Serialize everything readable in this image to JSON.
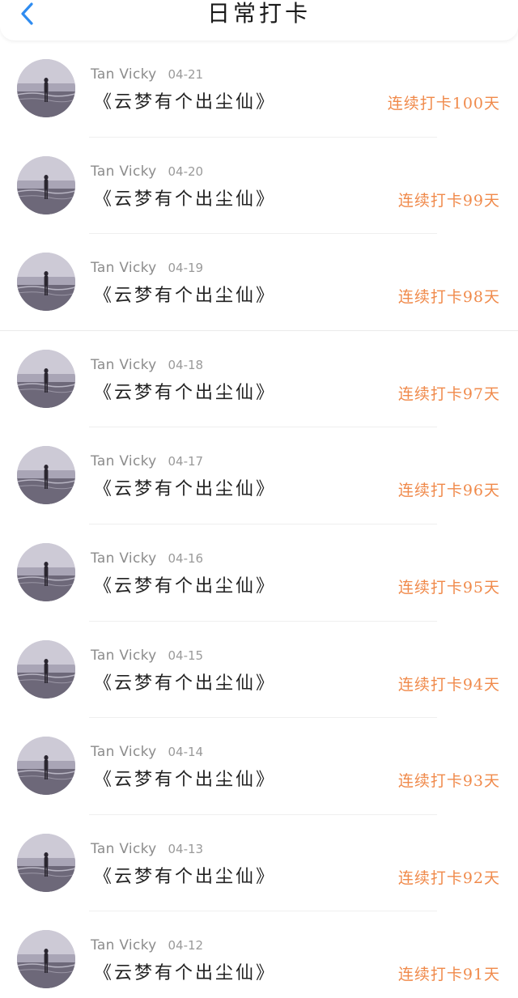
{
  "header": {
    "title": "日常打卡"
  },
  "colors": {
    "back_arrow": "#2f8cf0",
    "streak": "#f08a4b"
  },
  "entries": [
    {
      "user": "Tan Vicky",
      "date": "04-21",
      "book": "《云梦有个出尘仙》",
      "streak": "连续打卡100天"
    },
    {
      "user": "Tan Vicky",
      "date": "04-20",
      "book": "《云梦有个出尘仙》",
      "streak": "连续打卡99天"
    },
    {
      "user": "Tan Vicky",
      "date": "04-19",
      "book": "《云梦有个出尘仙》",
      "streak": "连续打卡98天"
    },
    {
      "user": "Tan Vicky",
      "date": "04-18",
      "book": "《云梦有个出尘仙》",
      "streak": "连续打卡97天"
    },
    {
      "user": "Tan Vicky",
      "date": "04-17",
      "book": "《云梦有个出尘仙》",
      "streak": "连续打卡96天"
    },
    {
      "user": "Tan Vicky",
      "date": "04-16",
      "book": "《云梦有个出尘仙》",
      "streak": "连续打卡95天"
    },
    {
      "user": "Tan Vicky",
      "date": "04-15",
      "book": "《云梦有个出尘仙》",
      "streak": "连续打卡94天"
    },
    {
      "user": "Tan Vicky",
      "date": "04-14",
      "book": "《云梦有个出尘仙》",
      "streak": "连续打卡93天"
    },
    {
      "user": "Tan Vicky",
      "date": "04-13",
      "book": "《云梦有个出尘仙》",
      "streak": "连续打卡92天"
    },
    {
      "user": "Tan Vicky",
      "date": "04-12",
      "book": "《云梦有个出尘仙》",
      "streak": "连续打卡91天"
    }
  ]
}
